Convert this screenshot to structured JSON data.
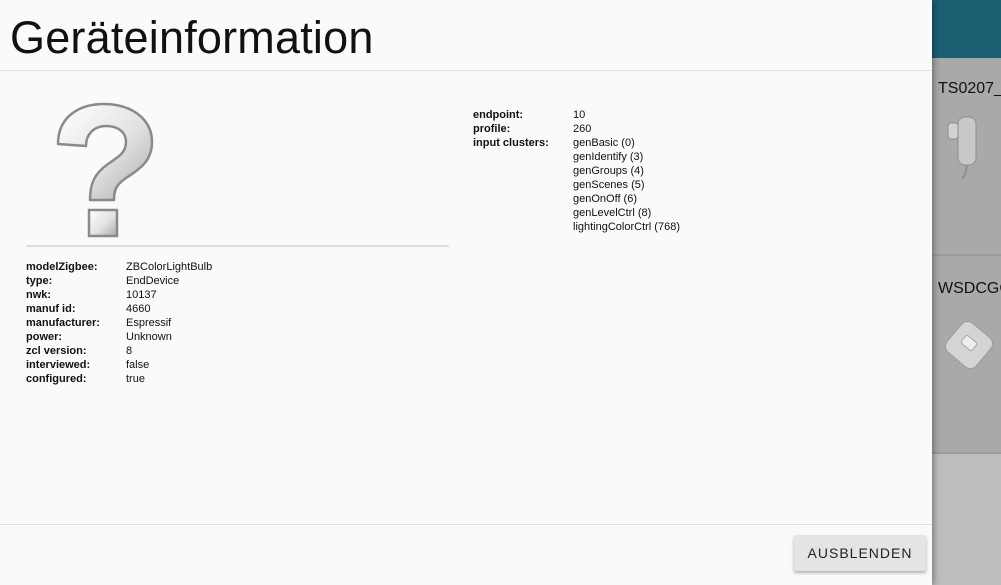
{
  "dialog": {
    "title": "Geräteinformation",
    "image_icon": "unknown-device-question-icon",
    "device_info": [
      {
        "key": "modelZigbee:",
        "value": "ZBColorLightBulb"
      },
      {
        "key": "type:",
        "value": "EndDevice"
      },
      {
        "key": "nwk:",
        "value": "10137"
      },
      {
        "key": "manuf id:",
        "value": "4660"
      },
      {
        "key": "manufacturer:",
        "value": "Espressif"
      },
      {
        "key": "power:",
        "value": "Unknown"
      },
      {
        "key": "zcl version:",
        "value": "8"
      },
      {
        "key": "interviewed:",
        "value": "false"
      },
      {
        "key": "configured:",
        "value": "true"
      }
    ],
    "endpoint": {
      "endpoint_label": "endpoint:",
      "endpoint_value": "10",
      "profile_label": "profile:",
      "profile_value": "260",
      "clusters_label": "input clusters:",
      "clusters": [
        "genBasic (0)",
        "genIdentify (3)",
        "genGroups (4)",
        "genScenes (5)",
        "genOnOff (6)",
        "genLevelCtrl (8)",
        "lightingColorCtrl (768)"
      ]
    },
    "hide_button_label": "AUSBLENDEN"
  },
  "background": {
    "header_color": "#1c5f72",
    "cards": [
      {
        "title": "TS0207_"
      },
      {
        "title": "WSDCGC"
      }
    ]
  }
}
